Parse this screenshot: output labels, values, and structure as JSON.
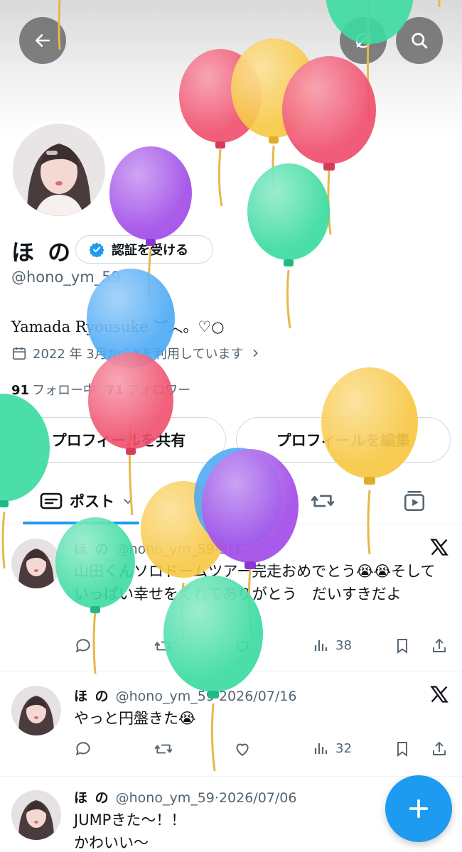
{
  "header": {
    "back_icon": "arrow-left-icon",
    "grok_icon": "slash-circle-icon",
    "search_icon": "search-icon"
  },
  "profile": {
    "name": "ほ の",
    "verify_label": "認証を受ける",
    "handle": "@hono_ym_59",
    "bio": "Yamada Ryousuke ︶︿。♡○",
    "joined": "2022 年 3月からXを利用しています",
    "following_count": "91",
    "following_label": "フォロー中",
    "followers_count": "71",
    "followers_label": "フォロワー",
    "share_label": "プロフィールを共有",
    "edit_label": "プロフィールを編集"
  },
  "tabs": {
    "posts_label": "ポスト",
    "likes_icon": "heart-icon",
    "reposts_icon": "repost-icon",
    "media_icon": "media-icon"
  },
  "posts": [
    {
      "name": "ほ の",
      "handle": "@hono_ym_59",
      "sep": "·",
      "date": "3日",
      "text": "山田くんソロドームツアー完走おめでとう😭😭そしていっぱい幸せをくれてありがとう　だいすきだよ",
      "views": "38"
    },
    {
      "name": "ほ の",
      "handle": "@hono_ym_59",
      "sep": "·",
      "date": "2026/07/16",
      "text": "やっと円盤きた😭",
      "views": "32"
    },
    {
      "name": "ほ の",
      "handle": "@hono_ym_59",
      "sep": "·",
      "date": "2026/07/06",
      "text_line1": "JUMPきた〜！！",
      "text_line2": "かわいい〜"
    }
  ],
  "fab": {
    "icon": "plus-icon"
  },
  "colors": {
    "accent": "#1d9bf0",
    "text": "#0f1419",
    "secondary": "#536471",
    "border": "#cfd9de",
    "balloon_red": "#f0506e",
    "balloon_yellow": "#f7c843",
    "balloon_green": "#3ddba2",
    "balloon_purple": "#a24ee8",
    "balloon_blue": "#4ba9f5"
  }
}
